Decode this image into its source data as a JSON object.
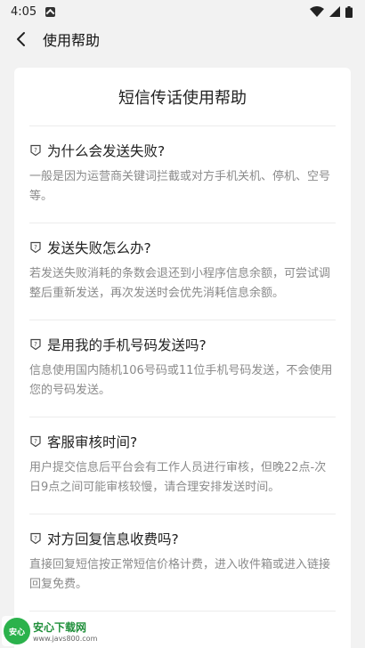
{
  "status_bar": {
    "time": "4:05"
  },
  "app_bar": {
    "title": "使用帮助"
  },
  "card": {
    "title": "短信传话使用帮助",
    "faqs": [
      {
        "question": "为什么会发送失败?",
        "answer": "一般是因为运营商关键词拦截或对方手机关机、停机、空号等。"
      },
      {
        "question": "发送失败怎么办?",
        "answer": "若发送失败消耗的条数会退还到小程序信息余额，可尝试调整后重新发送，再次发送时会优先消耗信息余额。"
      },
      {
        "question": "是用我的手机号码发送吗?",
        "answer": "信息使用国内随机106号码或11位手机号码发送，不会使用您的号码发送。"
      },
      {
        "question": "客服审核时间?",
        "answer": "用户提交信息后平台会有工作人员进行审核，但晚22点-次日9点之间可能审核较慢，请合理安排发送时间。"
      },
      {
        "question": "对方回复信息收费吗?",
        "answer": "直接回复短信按正常短信价格计费，进入收件箱或进入链接回复免费。"
      }
    ]
  },
  "watermark": {
    "name": "安心下载网",
    "url": "www.javs800.com"
  },
  "colors": {
    "background": "#f2f2f2",
    "card": "#ffffff",
    "answer_text": "#8a8a8a",
    "divider": "#ececec"
  },
  "icons": [
    "notification-icon",
    "wifi-icon",
    "signal-icon",
    "battery-icon",
    "back-arrow-icon",
    "question-shield-icon"
  ]
}
